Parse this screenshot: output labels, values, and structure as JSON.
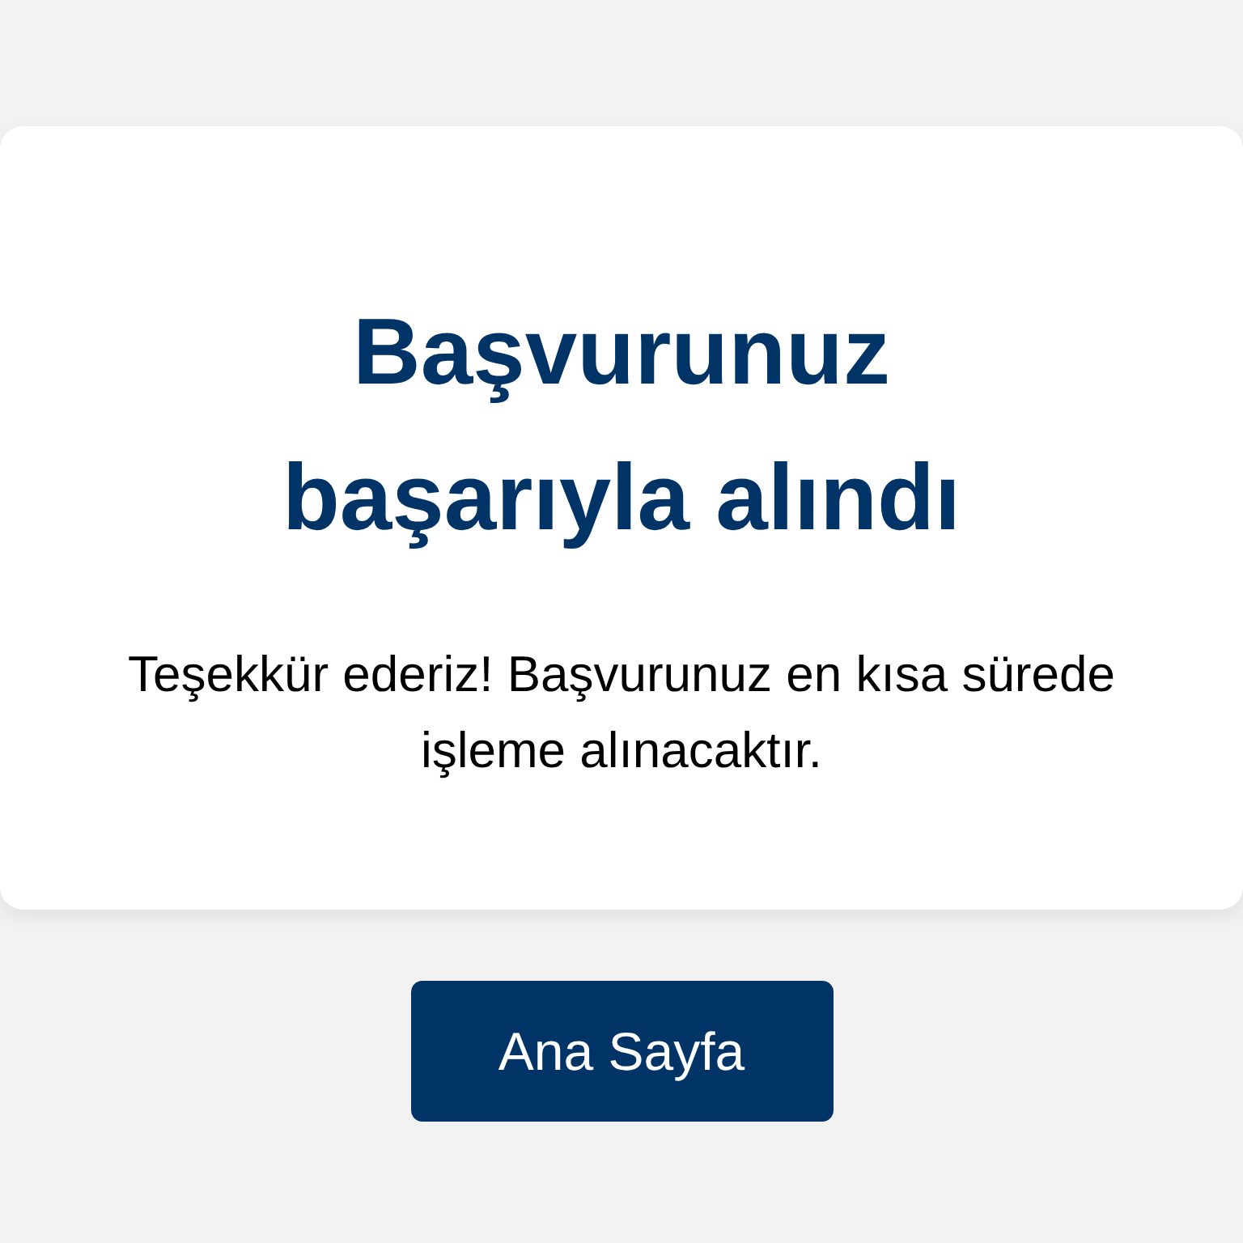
{
  "card": {
    "title": "Başvurunuz başarıyla alındı",
    "message": "Teşekkür ederiz! Başvurunuz en kısa sürede işleme alınacaktır."
  },
  "button": {
    "label": "Ana Sayfa"
  }
}
